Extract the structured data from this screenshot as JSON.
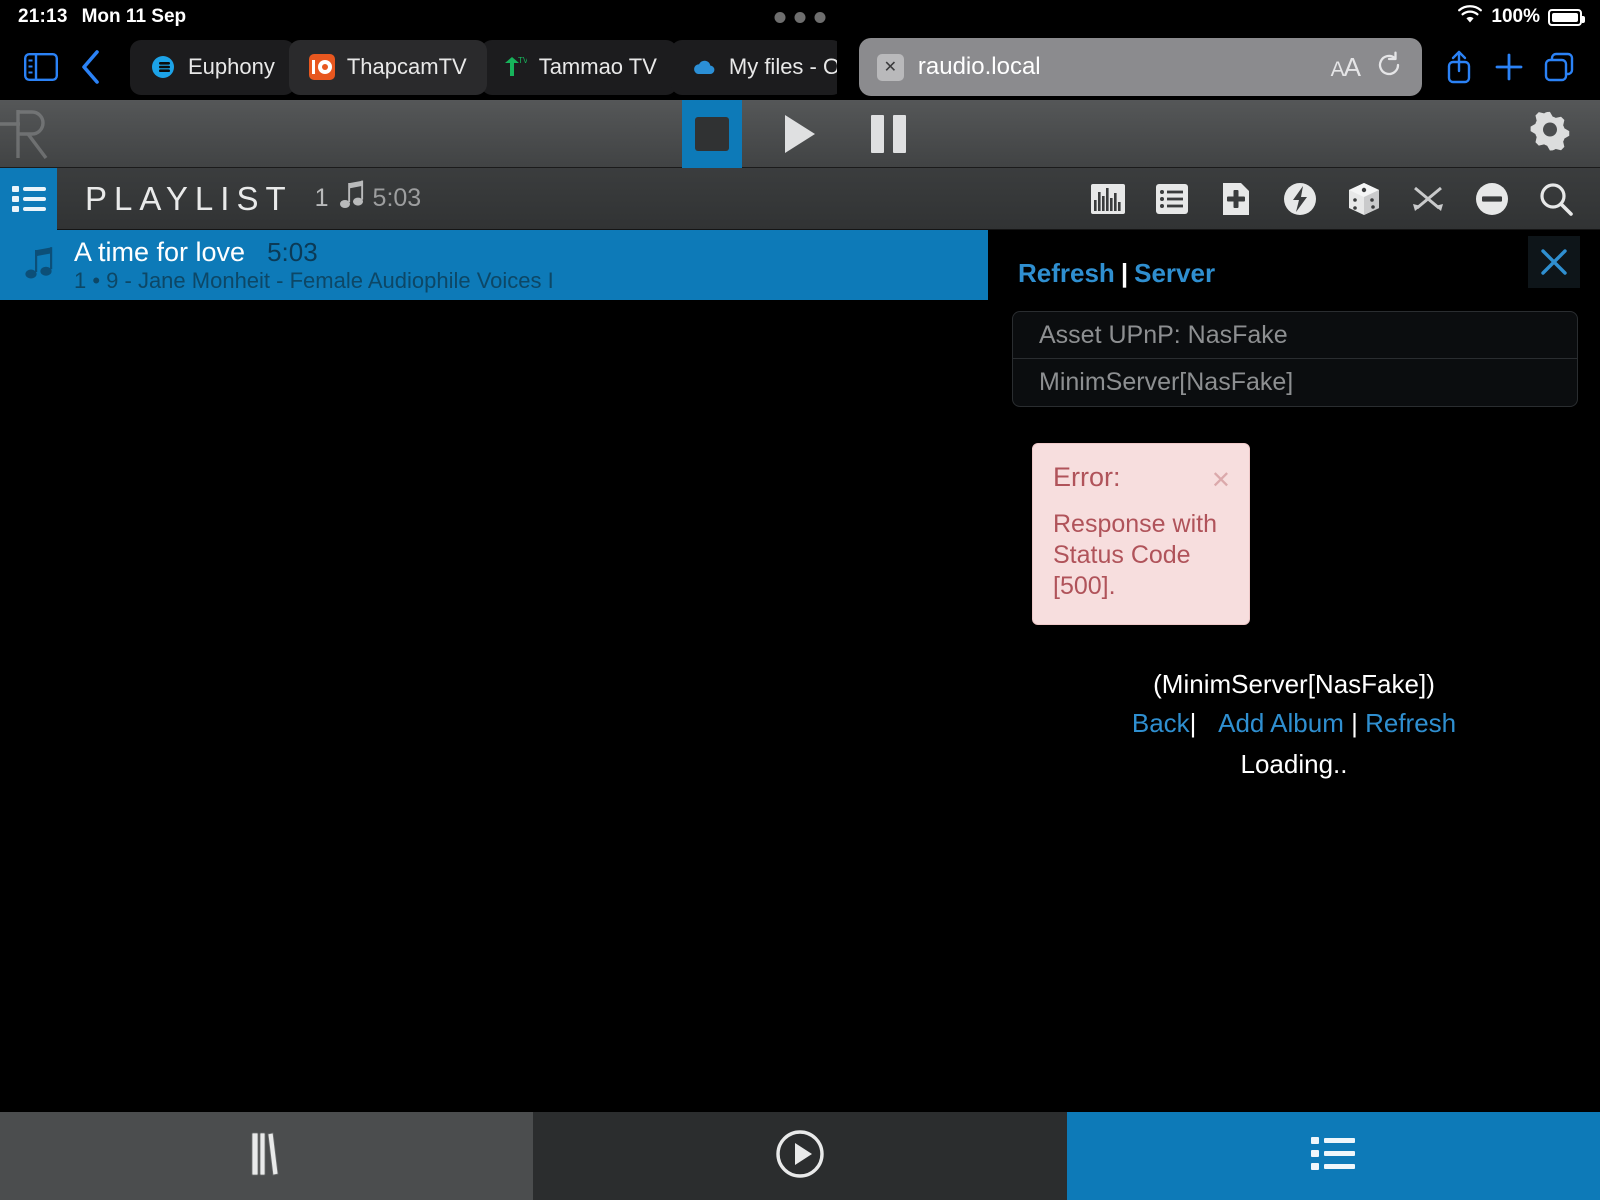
{
  "status_bar": {
    "time": "21:13",
    "date": "Mon 11 Sep",
    "battery_percent": "100%",
    "wifi_icon": "wifi-icon",
    "battery_icon": "battery-icon",
    "multitask_dots": "multitasking-dots"
  },
  "browser": {
    "sidebar_icon": "sidebar-toggle-icon",
    "back_icon": "back-chevron-icon",
    "tabs": [
      {
        "label": "Euphony",
        "favicon": "euphony-favicon"
      },
      {
        "label": "ThapcamTV",
        "favicon": "thapcamtv-favicon"
      },
      {
        "label": "Tammao TV",
        "favicon": "tammao-tv-favicon"
      },
      {
        "label": "My files - On",
        "favicon": "onedrive-favicon"
      }
    ],
    "url": "raudio.local",
    "url_clear_icon": "clear-url-icon",
    "text_size_label": "AA",
    "reload_icon": "reload-icon",
    "share_icon": "share-icon",
    "new_tab_icon": "new-tab-plus-icon",
    "tabs_overview_icon": "tabs-overview-icon"
  },
  "player": {
    "logo": "hr-logo",
    "stop_label": "Stop",
    "play_label": "Play",
    "pause_label": "Pause",
    "settings_label": "Settings",
    "accent_color": "#0d7ab8"
  },
  "playlist_header": {
    "icon": "playlist-icon",
    "title": "PLAYLIST",
    "count": "1",
    "note_icon": "music-note-icon",
    "duration": "5:03",
    "tools": [
      {
        "name": "spectrum-analyzer-icon",
        "label": "Spectrum"
      },
      {
        "name": "list-icon",
        "label": "List"
      },
      {
        "name": "add-file-icon",
        "label": "Add"
      },
      {
        "name": "lightning-icon",
        "label": "Quick"
      },
      {
        "name": "dice-icon",
        "label": "Random"
      },
      {
        "name": "shuffle-icon",
        "label": "Shuffle"
      },
      {
        "name": "remove-icon",
        "label": "Remove"
      },
      {
        "name": "search-icon",
        "label": "Search"
      }
    ]
  },
  "playlist": {
    "tracks": [
      {
        "title": "A time for love",
        "duration": "5:03",
        "subtitle": "1 • 9 - Jane Monheit - Female Audiophile Voices I",
        "note_icon": "music-note-icon"
      }
    ]
  },
  "browse_panel": {
    "close_icon": "close-panel-icon",
    "breadcrumb": {
      "refresh": "Refresh",
      "separator": "|",
      "server": "Server"
    },
    "servers": [
      "Asset UPnP: NasFake",
      "MinimServer[NasFake]"
    ],
    "error": {
      "title": "Error:",
      "message": "Response with Status Code [500].",
      "dismiss_icon": "dismiss-error-icon"
    },
    "current_server": "(MinimServer[NasFake])",
    "links": {
      "back": "Back",
      "sep1": "|",
      "add_album": "Add Album",
      "sep2": "|",
      "refresh": "Refresh"
    },
    "loading": "Loading.."
  },
  "bottom_nav": [
    {
      "name": "nav-library",
      "icon": "library-books-icon",
      "label": "Library",
      "active": false
    },
    {
      "name": "nav-playback",
      "icon": "play-circle-icon",
      "label": "Playback",
      "active": false
    },
    {
      "name": "nav-playlist",
      "icon": "playlist-list-icon",
      "label": "Playlist",
      "active": true
    }
  ]
}
